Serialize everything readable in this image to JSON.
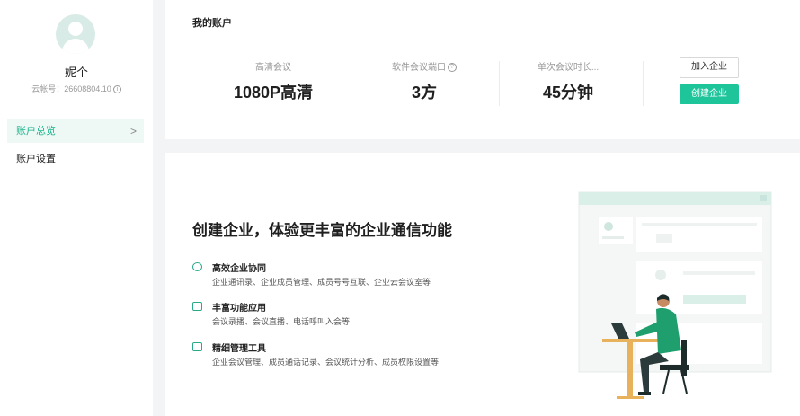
{
  "sidebar": {
    "username": "妮个",
    "cloud_id": "云帐号：26608804.10",
    "items": [
      {
        "label": "账户总览",
        "active": true
      },
      {
        "label": "账户设置",
        "active": false
      }
    ]
  },
  "account": {
    "title": "我的账户",
    "stats": [
      {
        "label": "高清会议",
        "value": "1080P高清"
      },
      {
        "label": "软件会议端口",
        "value": "3方"
      },
      {
        "label": "单次会议时长...",
        "value": "45分钟"
      }
    ],
    "join_label": "加入企业",
    "create_label": "创建企业"
  },
  "promo": {
    "title": "创建企业，体验更丰富的企业通信功能",
    "features": [
      {
        "name": "高效企业协同",
        "desc": "企业通讯录、企业成员管理、成员号号互联、企业云会议室等",
        "icon": "collab-icon"
      },
      {
        "name": "丰富功能应用",
        "desc": "会议录播、会议直播、电话呼叫入会等",
        "icon": "apps-icon"
      },
      {
        "name": "精细管理工具",
        "desc": "企业会议管理、成员通话记录、会议统计分析、成员权限设置等",
        "icon": "tools-icon"
      }
    ]
  },
  "colors": {
    "accent": "#1ec59b",
    "active_bg": "#eef8f5",
    "page_bg": "#f3f4f6"
  }
}
